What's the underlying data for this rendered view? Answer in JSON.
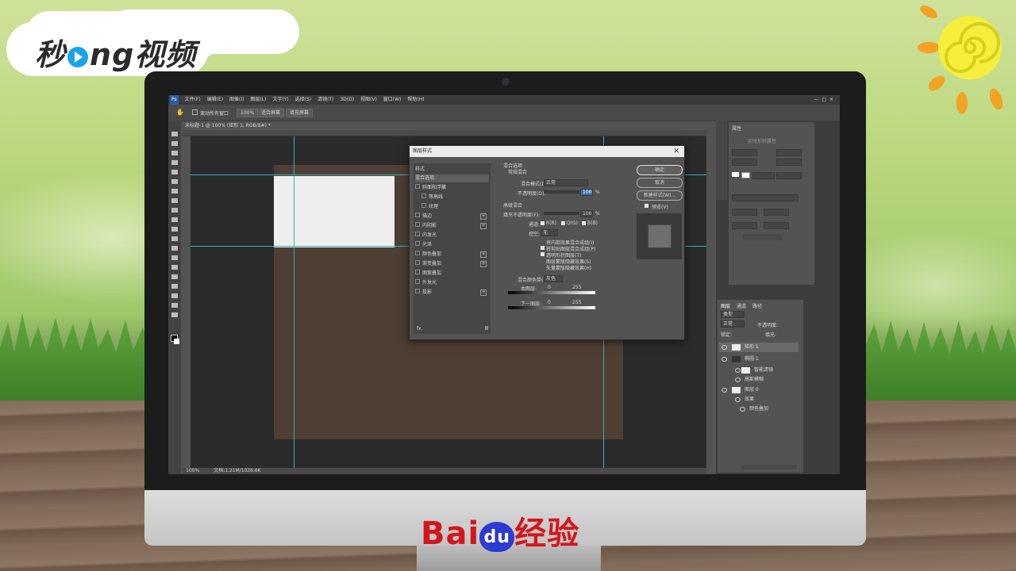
{
  "branding": {
    "logo_text_left": "秒",
    "logo_text_right": "ng视频",
    "baidu_left": "Bai",
    "baidu_du": "du",
    "baidu_right": "经验"
  },
  "menu": [
    "文件(F)",
    "编辑(E)",
    "图像(I)",
    "图层(L)",
    "文字(Y)",
    "选择(S)",
    "滤镜(T)",
    "3D(D)",
    "视图(V)",
    "窗口(W)",
    "帮助(H)"
  ],
  "options_bar": {
    "scroll_all_windows": "滚动所有窗口",
    "zoom": "100%",
    "fit_screen": "适合屏幕",
    "fill_screen": "填充屏幕"
  },
  "document_tab": "未标题-1 @ 100% (矩形 1, RGB/8#) *",
  "status_bar": {
    "zoom": "100%",
    "doc": "文档:1.21M/1026.6K"
  },
  "dialog": {
    "title": "图层样式",
    "style_list": [
      {
        "label": "样式"
      },
      {
        "label": "混合选项",
        "selected": true
      },
      {
        "label": "斜面和浮雕",
        "checkbox": true
      },
      {
        "label": "等高线",
        "checkbox": true,
        "indent": true
      },
      {
        "label": "纹理",
        "checkbox": true,
        "indent": true
      },
      {
        "label": "描边",
        "checkbox": true,
        "plus": true
      },
      {
        "label": "内阴影",
        "checkbox": true,
        "plus": true
      },
      {
        "label": "内发光",
        "checkbox": true
      },
      {
        "label": "光泽",
        "checkbox": true
      },
      {
        "label": "颜色叠加",
        "checkbox": true,
        "plus": true
      },
      {
        "label": "渐变叠加",
        "checkbox": true,
        "plus": true
      },
      {
        "label": "图案叠加",
        "checkbox": true
      },
      {
        "label": "外发光",
        "checkbox": true
      },
      {
        "label": "投影",
        "checkbox": true,
        "plus": true
      }
    ],
    "fx_label": "fx.",
    "blend_options": {
      "section": "混合选项",
      "general": "常规混合",
      "mode_label": "混合模式(D):",
      "mode_value": "正常",
      "opacity_label": "不透明度(O):",
      "opacity_value": "100",
      "percent": "%",
      "advanced": "高级混合",
      "fill_label": "填充不透明度(F):",
      "fill_value": "100",
      "channels_label": "通道:",
      "channel_r": "R(R)",
      "channel_g": "G(G)",
      "channel_b": "B(B)",
      "knockout_label": "挖空:",
      "knockout_value": "无",
      "opt1": "将内部效果混合成组(I)",
      "opt2": "将剪贴图层混合成组(P)",
      "opt3": "透明形状图层(T)",
      "opt4": "图层蒙版隐藏效果(S)",
      "opt5": "矢量蒙版隐藏效果(H)",
      "blend_if_label": "混合颜色带(E):",
      "blend_if_value": "灰色",
      "this_layer": "本图层:",
      "underlying": "下一图层:",
      "min": "0",
      "max": "255"
    },
    "buttons": {
      "ok": "确定",
      "cancel": "取消",
      "new_style": "新建样式(W)...",
      "preview": "预览(V)"
    }
  },
  "panels": {
    "properties_title": "属性",
    "properties_sub": "实时形状属性",
    "layers_tabs": [
      "图层",
      "通道",
      "路径"
    ],
    "search_placeholder": "类型",
    "blend": "正常",
    "opacity": "不透明度:",
    "fill": "填充:",
    "lock": "锁定:",
    "layers": [
      {
        "name": "矩形 1",
        "level": 0
      },
      {
        "name": "椭圆 1",
        "level": 0
      },
      {
        "name": "智能滤镜",
        "level": 1
      },
      {
        "name": "高斯模糊",
        "level": 2
      },
      {
        "name": "图层 0",
        "level": 0
      },
      {
        "name": "效果",
        "level": 1
      },
      {
        "name": "颜色叠加",
        "level": 2
      }
    ]
  },
  "colors": {
    "accent_guides": "#2fb3c4",
    "doc_bg": "#4f3e33",
    "baidu_red": "#d4161c",
    "baidu_blue": "#2d3bd3"
  }
}
